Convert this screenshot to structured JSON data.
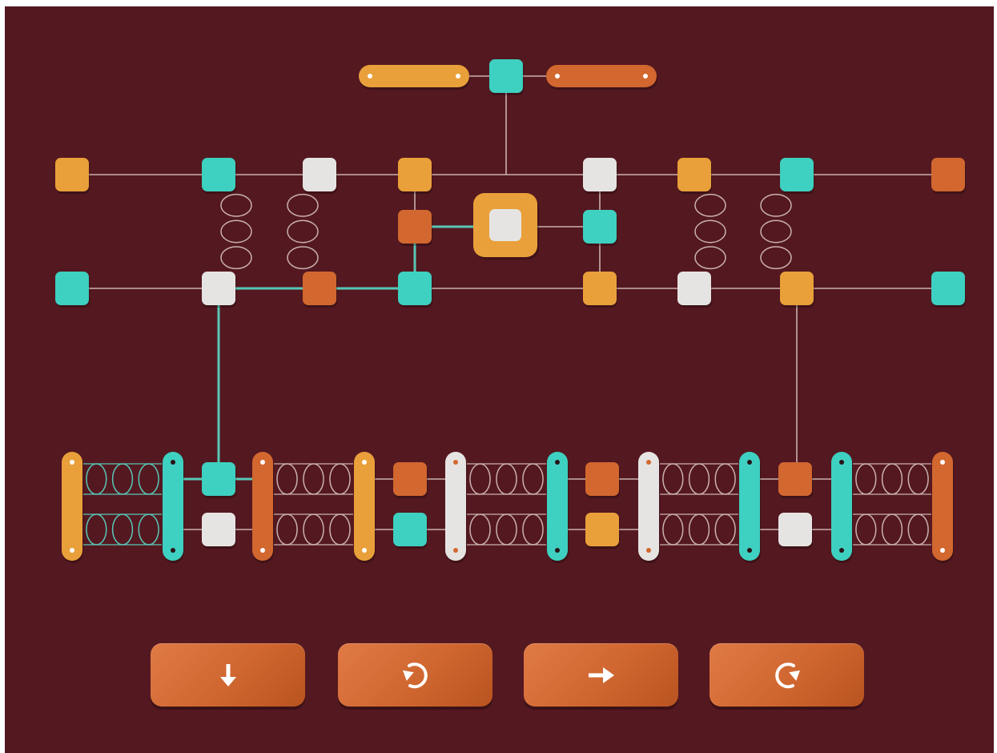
{
  "colors": {
    "background": "#541820",
    "orange": "#e9a03a",
    "rust": "#d2672f",
    "teal": "#3ed0c0",
    "white": "#e6e4e2",
    "line": "#c9b1ae",
    "line_active": "#58c7b6"
  },
  "controls": [
    {
      "name": "down-arrow-icon",
      "glyph": "arrow-down"
    },
    {
      "name": "rotate-ccw-icon",
      "glyph": "rotate-counterclockwise"
    },
    {
      "name": "right-arrow-icon",
      "glyph": "arrow-right"
    },
    {
      "name": "rotate-cw-icon",
      "glyph": "rotate-clockwise"
    }
  ],
  "board": {
    "top_bars": [
      "orange",
      "rust"
    ],
    "top_node": "teal",
    "row1": [
      "orange",
      "teal",
      "white",
      "orange",
      "white",
      "orange",
      "teal",
      "rust"
    ],
    "row2": [
      "teal",
      "white",
      "rust",
      "teal",
      "orange",
      "white",
      "orange",
      "teal"
    ],
    "middle_nodes": [
      "rust",
      "teal"
    ],
    "center_piece": {
      "outer": "orange",
      "inner": "white"
    },
    "bottom_bars": [
      "orange",
      "teal",
      "rust",
      "orange",
      "white",
      "teal",
      "white",
      "teal",
      "teal",
      "rust"
    ],
    "bottom_pairs": [
      [
        "teal",
        "white"
      ],
      [
        "rust",
        "teal"
      ],
      [
        "rust",
        "orange"
      ],
      [
        "rust",
        "white"
      ]
    ]
  }
}
